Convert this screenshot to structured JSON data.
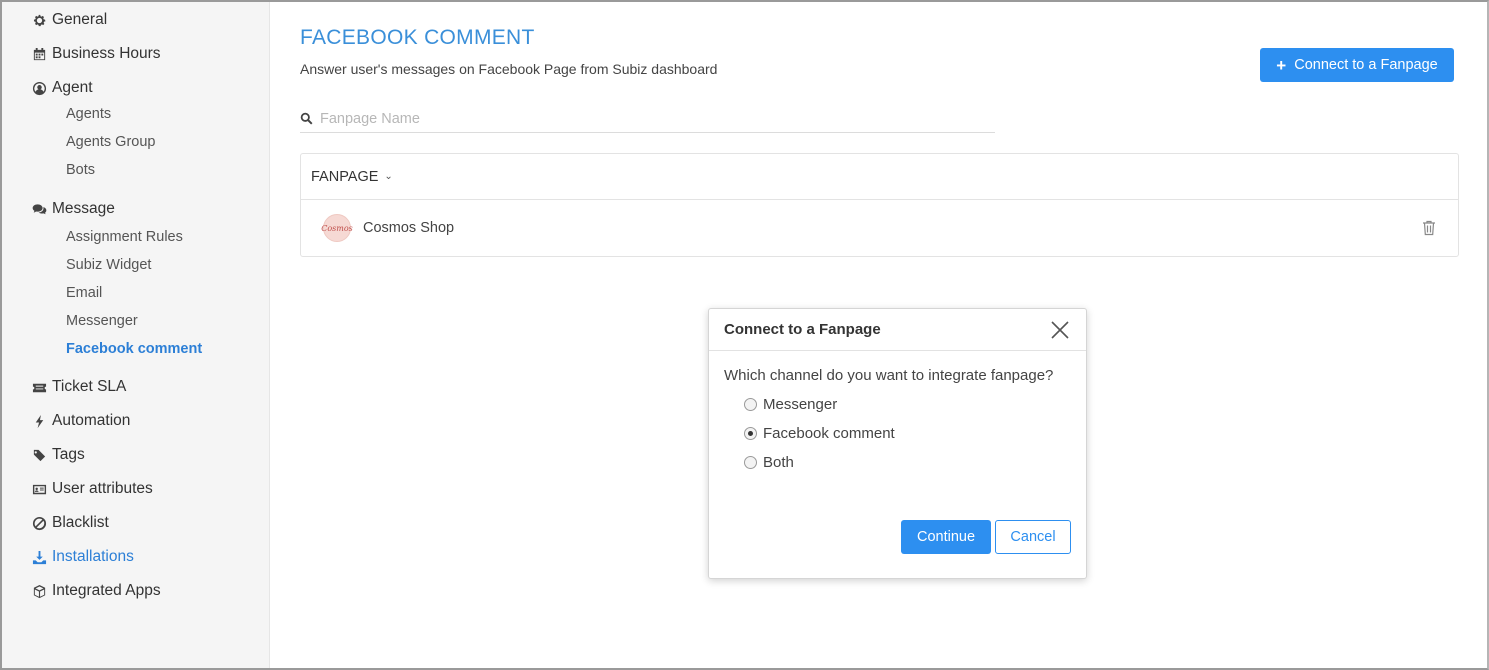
{
  "sidebar": {
    "items": [
      {
        "label": "General",
        "icon": "gear-icon"
      },
      {
        "label": "Business Hours",
        "icon": "calendar-icon"
      },
      {
        "label": "Agent",
        "icon": "user-circle-icon"
      },
      {
        "label": "Message",
        "icon": "chat-bubbles-icon"
      },
      {
        "label": "Ticket SLA",
        "icon": "ticket-icon"
      },
      {
        "label": "Automation",
        "icon": "lightning-icon"
      },
      {
        "label": "Tags",
        "icon": "tags-icon"
      },
      {
        "label": "User attributes",
        "icon": "id-card-icon"
      },
      {
        "label": "Blacklist",
        "icon": "ban-icon"
      },
      {
        "label": "Installations",
        "icon": "download-icon"
      },
      {
        "label": "Integrated Apps",
        "icon": "cube-icon"
      }
    ],
    "agent_sub": [
      "Agents",
      "Agents Group",
      "Bots"
    ],
    "message_sub": [
      "Assignment Rules",
      "Subiz Widget",
      "Email",
      "Messenger",
      "Facebook comment"
    ],
    "active_item": "Facebook comment"
  },
  "main": {
    "title": "FACEBOOK COMMENT",
    "subtitle": "Answer user's messages on Facebook Page from Subiz dashboard",
    "connect_button": "Connect to a Fanpage",
    "search_placeholder": "Fanpage Name",
    "table": {
      "header": "FANPAGE",
      "rows": [
        {
          "name": "Cosmos Shop",
          "avatar_text": "Cosmos"
        }
      ]
    }
  },
  "modal": {
    "title": "Connect to a Fanpage",
    "question": "Which channel do you want to integrate fanpage?",
    "options": [
      {
        "label": "Messenger",
        "checked": false
      },
      {
        "label": "Facebook comment",
        "checked": true
      },
      {
        "label": "Both",
        "checked": false
      }
    ],
    "continue_label": "Continue",
    "cancel_label": "Cancel"
  },
  "colors": {
    "accent": "#2d8ff0",
    "title": "#3a8fd9",
    "active_link": "#2c7fd6"
  }
}
